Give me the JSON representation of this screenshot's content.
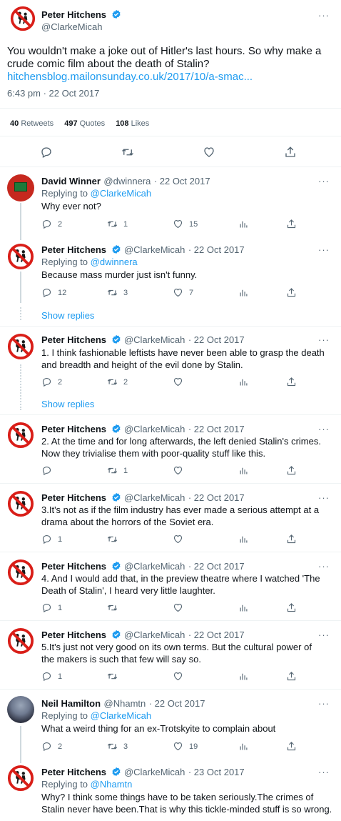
{
  "main": {
    "name": "Peter Hitchens",
    "handle": "@ClarkeMicah",
    "text": "You wouldn't make a joke out of Hitler's last hours. So why make a crude comic film about the death of Stalin?",
    "link": "hitchensblog.mailonsunday.co.uk/2017/10/a-smac...",
    "timestamp": "6:43 pm · 22 Oct 2017",
    "stats": {
      "retweets_n": "40",
      "retweets_l": "Retweets",
      "quotes_n": "497",
      "quotes_l": "Quotes",
      "likes_n": "108",
      "likes_l": "Likes"
    }
  },
  "more_label": "···",
  "replying_to": "Replying to",
  "show_replies": "Show replies",
  "replies": [
    {
      "name": "David Winner",
      "handle": "@dwinnera",
      "date": "· 22 Oct 2017",
      "reply_to": "@ClarkeMicah",
      "text": "Why ever not?",
      "reply": "2",
      "retweet": "1",
      "like": "15"
    },
    {
      "name": "Peter Hitchens",
      "handle": "@ClarkeMicah",
      "date": "· 22 Oct 2017",
      "reply_to": "@dwinnera",
      "text": "Because mass murder just isn't funny.",
      "reply": "12",
      "retweet": "3",
      "like": "7"
    },
    {
      "name": "Peter Hitchens",
      "handle": "@ClarkeMicah",
      "date": "· 22 Oct 2017",
      "text": "1. I think fashionable leftists have never been able to grasp the death and breadth and height of the evil done by Stalin.",
      "reply": "2",
      "retweet": "2",
      "like": ""
    },
    {
      "name": "Peter Hitchens",
      "handle": "@ClarkeMicah",
      "date": "· 22 Oct 2017",
      "text": "2. At the time and for long afterwards, the left denied Stalin's crimes. Now they trivialise them with  poor-quality stuff like this.",
      "reply": "",
      "retweet": "1",
      "like": ""
    },
    {
      "name": "Peter Hitchens",
      "handle": "@ClarkeMicah",
      "date": "· 22 Oct 2017",
      "text": "3.It's not as if the film industry has ever made a serious attempt at a drama about the horrors of the Soviet era.",
      "reply": "1",
      "retweet": "",
      "like": ""
    },
    {
      "name": "Peter Hitchens",
      "handle": "@ClarkeMicah",
      "date": "· 22 Oct 2017",
      "text": "4. And I would add that, in the preview theatre where I watched 'The Death of Stalin', I heard very little laughter.",
      "reply": "1",
      "retweet": "",
      "like": ""
    },
    {
      "name": "Peter Hitchens",
      "handle": "@ClarkeMicah",
      "date": "· 22 Oct 2017",
      "text": "5.It's just not very good on its own terms. But the cultural power of the makers is such that few will say so.",
      "reply": "1",
      "retweet": "",
      "like": ""
    },
    {
      "name": "Neil Hamilton",
      "handle": "@Nhamtn",
      "date": "· 22 Oct 2017",
      "reply_to": "@ClarkeMicah",
      "text": "What a weird thing for an ex-Trotskyite to complain about",
      "reply": "2",
      "retweet": "3",
      "like": "19"
    },
    {
      "name": "Peter Hitchens",
      "handle": "@ClarkeMicah",
      "date": "· 23 Oct 2017",
      "reply_to": "@Nhamtn",
      "text": "Why? I think some things have to be taken seriously.The crimes of Stalin never have been.That is why this tickle-minded stuff is so wrong.",
      "reply": "",
      "retweet": "",
      "like": ""
    }
  ],
  "colors": {
    "accent": "#1d9bf0",
    "text": "#0f1419",
    "secondary": "#536471"
  }
}
